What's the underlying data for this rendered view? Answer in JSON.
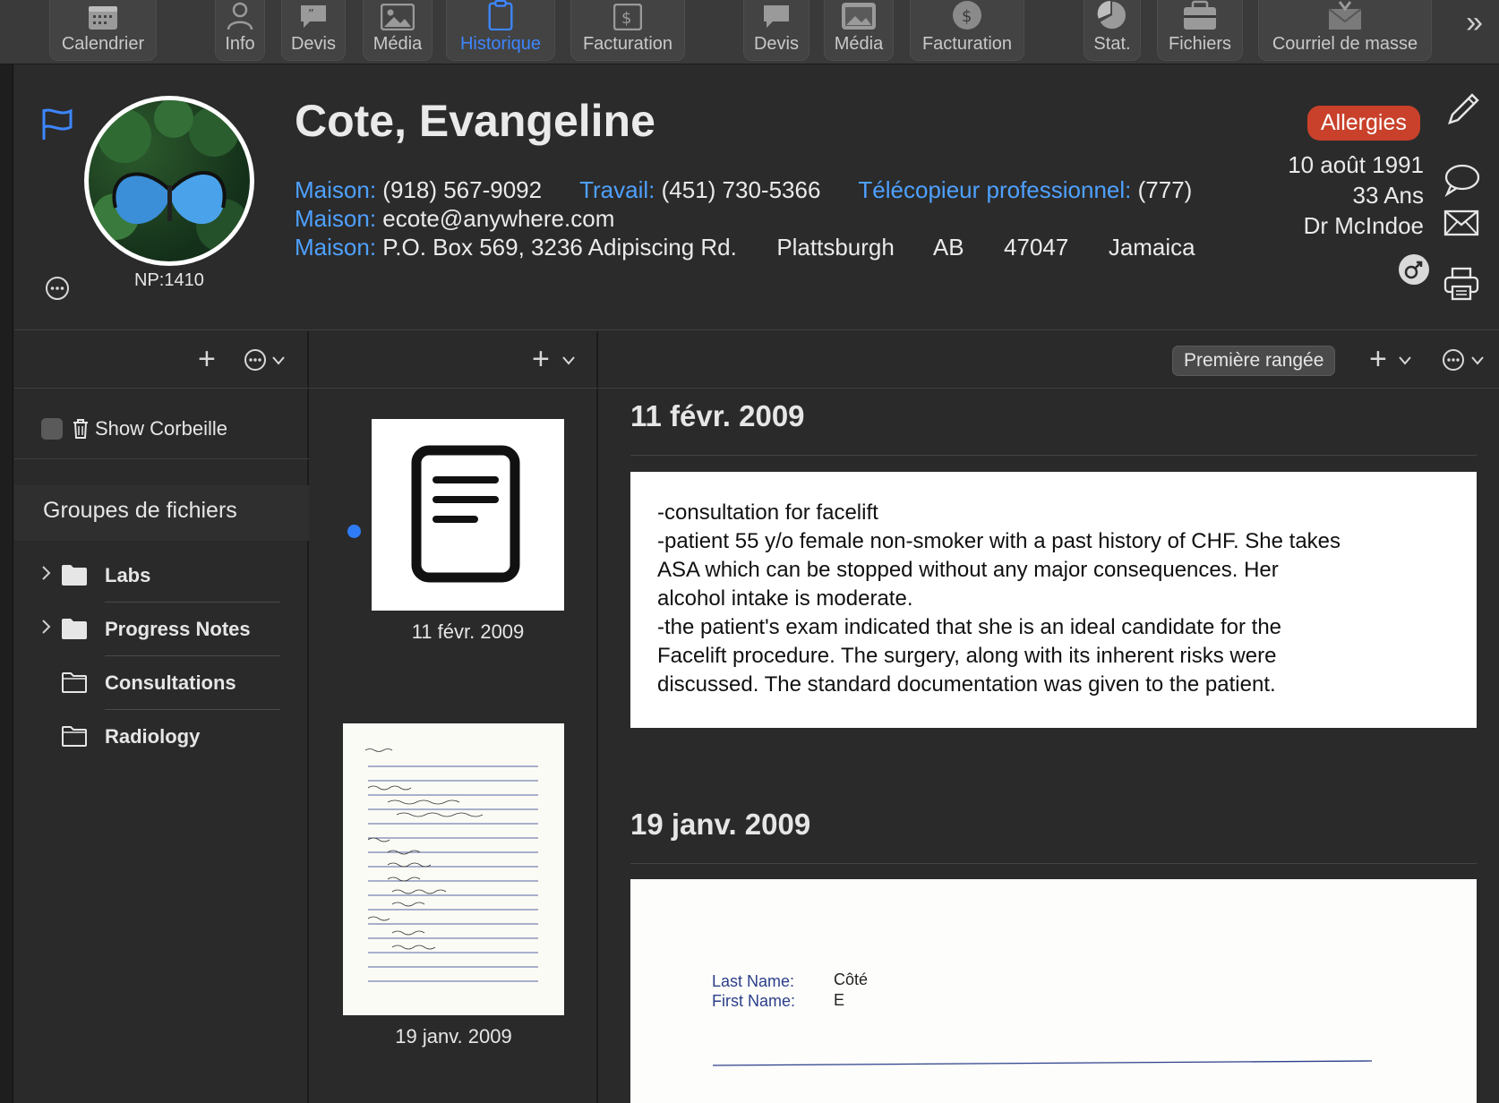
{
  "toolbar": {
    "items": [
      {
        "label": "Calendrier",
        "icon": "calendar-icon"
      },
      {
        "label": "Info",
        "icon": "person-icon"
      },
      {
        "label": "Devis",
        "icon": "quote-bubble-icon"
      },
      {
        "label": "Média",
        "icon": "photo-icon"
      },
      {
        "label": "Historique",
        "icon": "clipboard-icon",
        "active": true
      },
      {
        "label": "Facturation",
        "icon": "dollar-doc-icon"
      },
      {
        "label": "Devis",
        "icon": "quote-bubble-icon"
      },
      {
        "label": "Média",
        "icon": "photo-icon"
      },
      {
        "label": "Facturation",
        "icon": "dollar-circle-icon"
      },
      {
        "label": "Stat.",
        "icon": "pie-chart-icon"
      },
      {
        "label": "Fichiers",
        "icon": "file-cabinet-icon"
      },
      {
        "label": "Courriel de masse",
        "icon": "mass-mail-icon"
      }
    ]
  },
  "patient": {
    "name": "Cote, Evangeline",
    "np": "NP:1410",
    "allergies_label": "Allergies",
    "dob": "10 août 1991",
    "age": "33 Ans",
    "doctor": "Dr McIndoe",
    "phones": {
      "home_label": "Maison:",
      "home": "(918) 567-9092",
      "work_label": "Travail:",
      "work": "(451) 730-5366",
      "fax_label": "Télécopieur professionnel:",
      "fax": "(777)"
    },
    "email_label": "Maison:",
    "email": "ecote@anywhere.com",
    "address_label": "Maison:",
    "address": {
      "street": "P.O. Box 569, 3236 Adipiscing Rd.",
      "city": "Plattsburgh",
      "province": "AB",
      "postal": "47047",
      "country": "Jamaica"
    }
  },
  "files_pane": {
    "show_trash_label": "Show Corbeille",
    "groups_title": "Groupes de fichiers",
    "folders": [
      {
        "name": "Labs",
        "expandable": true,
        "filled": true
      },
      {
        "name": "Progress Notes",
        "expandable": true,
        "filled": true
      },
      {
        "name": "Consultations",
        "expandable": false,
        "filled": false
      },
      {
        "name": "Radiology",
        "expandable": false,
        "filled": false
      }
    ]
  },
  "thumbs_pane": {
    "items": [
      {
        "date": "11 févr. 2009"
      },
      {
        "date": "19 janv. 2009"
      }
    ]
  },
  "history_pane": {
    "first_row_label": "Première rangée",
    "entries": [
      {
        "date": "11 févr. 2009",
        "lines": [
          "-consultation for facelift",
          "-patient 55 y/o female non-smoker with a past history of CHF. She takes",
          "ASA which can be stopped without any major consequences. Her",
          "alcohol intake is moderate.",
          "-the patient's exam indicated that she is an ideal candidate for the",
          "Facelift procedure. The surgery, along with its inherent risks were",
          "discussed. The standard documentation was given to the patient."
        ]
      },
      {
        "date": "19 janv. 2009",
        "form": {
          "last_name_label": "Last Name:",
          "last_name": "Côté",
          "first_name_label": "First Name:",
          "first_name": "E"
        }
      }
    ]
  },
  "colors": {
    "accent": "#3d86ff",
    "label_blue": "#4ea1ff",
    "allergy_red": "#c9412b",
    "background": "#2a2a2a"
  }
}
